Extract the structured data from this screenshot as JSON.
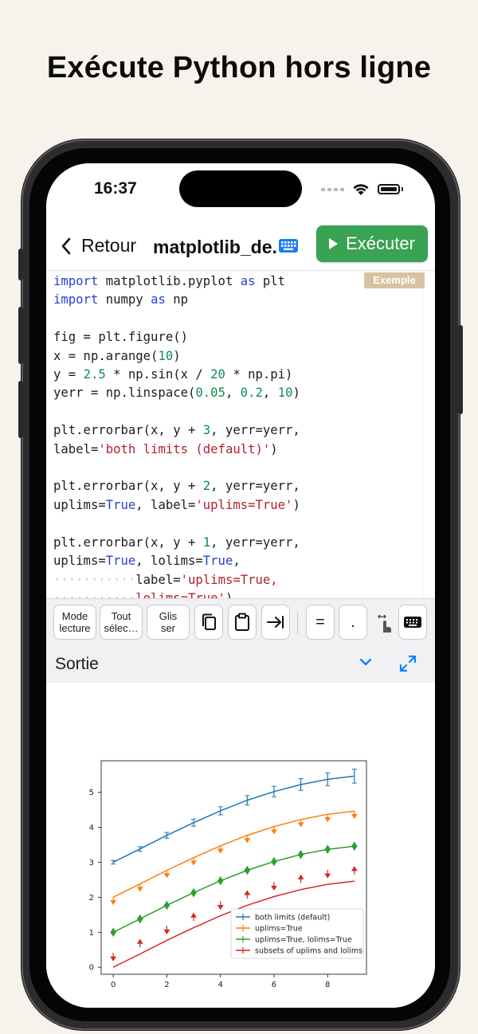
{
  "headline": "Exécute Python hors ligne",
  "status_bar": {
    "time": "16:37"
  },
  "nav": {
    "back_label": "Retour",
    "file_title": "matplotlib_de.",
    "run_label": "Exécuter"
  },
  "editor": {
    "badge": "Exemple"
  },
  "toolbar": {
    "read_mode": [
      "Mode",
      "lecture"
    ],
    "select_all": [
      "Tout",
      "sélec…"
    ],
    "drag": [
      "Glis",
      "ser"
    ],
    "equals": "=",
    "dot": "."
  },
  "output": {
    "title": "Sortie"
  },
  "colors": {
    "run_button": "#3aa253",
    "badge": "#d8c3a0",
    "accent": "#0a84ff"
  },
  "icons": [
    "chevron-left-icon",
    "keyboard-icon",
    "play-icon",
    "copy-icon",
    "paste-icon",
    "tab-icon",
    "drag-cursor-icon",
    "hide-keyboard-icon",
    "chevron-down-icon",
    "expand-icon",
    "wifi-icon",
    "battery-icon"
  ],
  "chart_data": {
    "type": "line",
    "title": "",
    "xlabel": "",
    "ylabel": "",
    "x": [
      0,
      1,
      2,
      3,
      4,
      5,
      6,
      7,
      8,
      9
    ],
    "xlim": [
      -0.45,
      9.45
    ],
    "ylim": [
      -0.2,
      5.9
    ],
    "x_ticks": [
      "0",
      "2",
      "4",
      "6",
      "8"
    ],
    "y_ticks": [
      "0",
      "1",
      "2",
      "3",
      "4",
      "5"
    ],
    "legend_position": "lower-right",
    "series": [
      {
        "name": "both limits (default)",
        "color": "#1f77b4",
        "values": [
          3.0,
          3.38,
          3.77,
          4.13,
          4.47,
          4.77,
          5.02,
          5.22,
          5.37,
          5.46
        ],
        "yerr": [
          0.05,
          0.067,
          0.083,
          0.1,
          0.117,
          0.133,
          0.15,
          0.167,
          0.183,
          0.2
        ],
        "limits": "both"
      },
      {
        "name": "uplims=True",
        "color": "#ff7f0e",
        "values": [
          2.0,
          2.38,
          2.77,
          3.13,
          3.47,
          3.77,
          4.02,
          4.22,
          4.37,
          4.46
        ],
        "yerr": [
          0.05,
          0.067,
          0.083,
          0.1,
          0.117,
          0.133,
          0.15,
          0.167,
          0.183,
          0.2
        ],
        "limits": "upper"
      },
      {
        "name": "uplims=True, lolims=True",
        "color": "#2ca02c",
        "values": [
          1.0,
          1.38,
          1.77,
          2.13,
          2.47,
          2.77,
          3.02,
          3.22,
          3.37,
          3.46
        ],
        "yerr": [
          0.05,
          0.067,
          0.083,
          0.1,
          0.117,
          0.133,
          0.15,
          0.167,
          0.183,
          0.2
        ],
        "limits": "both-arrows"
      },
      {
        "name": "subsets of uplims and lolims",
        "color": "#d62728",
        "values": [
          0.0,
          0.38,
          0.77,
          1.13,
          1.47,
          1.77,
          2.02,
          2.22,
          2.37,
          2.46
        ],
        "yerr": [
          0.05,
          0.067,
          0.083,
          0.1,
          0.117,
          0.133,
          0.15,
          0.167,
          0.183,
          0.2
        ],
        "limits": "subsets"
      }
    ]
  }
}
